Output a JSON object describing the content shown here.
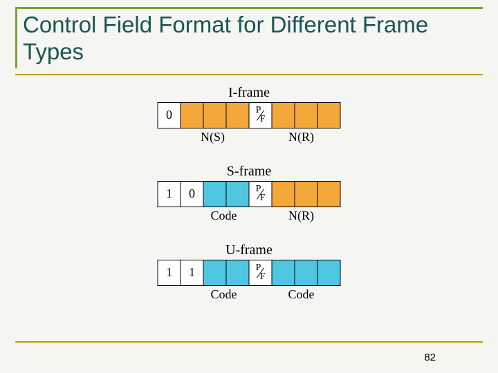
{
  "title": "Control Field Format for Different Frame Types",
  "page_number": "82",
  "pf": {
    "p": "P",
    "f": "F"
  },
  "frames": {
    "iframe": {
      "title": "I-frame",
      "cells": [
        "0",
        "",
        "",
        "",
        "",
        "",
        "",
        ""
      ],
      "labels": {
        "ns": "N(S)",
        "nr": "N(R)"
      }
    },
    "sframe": {
      "title": "S-frame",
      "cells": [
        "1",
        "0",
        "",
        "",
        "",
        "",
        "",
        ""
      ],
      "labels": {
        "code": "Code",
        "nr": "N(R)"
      }
    },
    "uframe": {
      "title": "U-frame",
      "cells": [
        "1",
        "1",
        "",
        "",
        "",
        "",
        "",
        ""
      ],
      "labels": {
        "code1": "Code",
        "code2": "Code"
      }
    }
  }
}
